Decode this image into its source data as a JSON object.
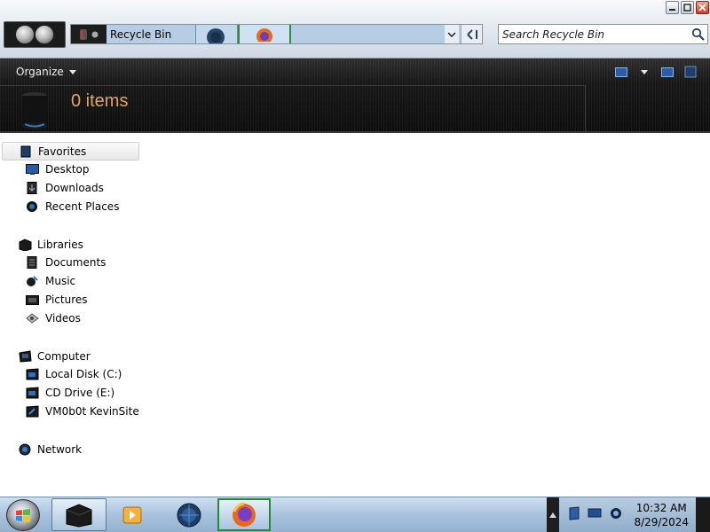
{
  "window": {
    "address_text": "Recycle Bin",
    "search_placeholder": "Search Recycle Bin"
  },
  "toolbar": {
    "organize_label": "Organize"
  },
  "details": {
    "items_count": "0 items"
  },
  "nav": {
    "favorites": {
      "label": "Favorites",
      "items": [
        {
          "label": "Desktop",
          "icon": "desktop-icon"
        },
        {
          "label": "Downloads",
          "icon": "downloads-icon"
        },
        {
          "label": "Recent Places",
          "icon": "recent-places-icon"
        }
      ]
    },
    "libraries": {
      "label": "Libraries",
      "items": [
        {
          "label": "Documents",
          "icon": "documents-icon"
        },
        {
          "label": "Music",
          "icon": "music-icon"
        },
        {
          "label": "Pictures",
          "icon": "pictures-icon"
        },
        {
          "label": "Videos",
          "icon": "videos-icon"
        }
      ]
    },
    "computer": {
      "label": "Computer",
      "items": [
        {
          "label": "Local Disk (C:)",
          "icon": "local-disk-icon"
        },
        {
          "label": "CD Drive (E:)",
          "icon": "cd-drive-icon"
        },
        {
          "label": "VM0b0t KevinSite",
          "icon": "network-drive-icon"
        }
      ]
    },
    "network": {
      "label": "Network"
    }
  },
  "taskbar": {
    "time": "10:32 AM",
    "date": "8/29/2024"
  },
  "colors": {
    "toolbar_bg": "#161616",
    "items_count_text": "#e8a35a",
    "taskbar_bg": "#a9c3de"
  }
}
